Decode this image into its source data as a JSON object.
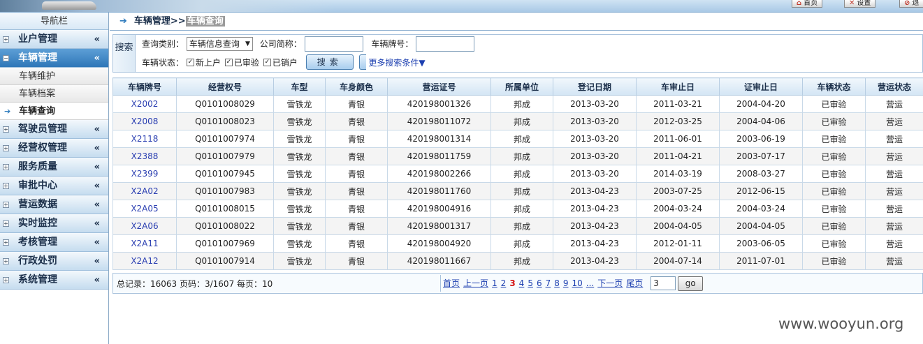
{
  "header": {
    "buttons": [
      {
        "label": "首页",
        "icon": "home-icon"
      },
      {
        "label": "设置",
        "icon": "settings-icon"
      },
      {
        "label": "退",
        "icon": "logout-icon"
      }
    ]
  },
  "sidebar": {
    "title": "导航栏",
    "chevron": "«",
    "menus": [
      {
        "label": "业户管理"
      },
      {
        "label": "车辆管理",
        "active": true,
        "children": [
          {
            "label": "车辆维护"
          },
          {
            "label": "车辆档案"
          },
          {
            "label": "车辆查询",
            "current": true
          }
        ]
      },
      {
        "label": "驾驶员管理"
      },
      {
        "label": "经营权管理"
      },
      {
        "label": "服务质量"
      },
      {
        "label": "审批中心"
      },
      {
        "label": "营运数据"
      },
      {
        "label": "实时监控"
      },
      {
        "label": "考核管理"
      },
      {
        "label": "行政处罚"
      },
      {
        "label": "系统管理"
      }
    ]
  },
  "breadcrumb": {
    "parent": "车辆管理>>",
    "current": "车辆查询"
  },
  "search": {
    "panel_label": "搜索",
    "query_type_label": "查询类别：",
    "query_type_value": "车辆信息查询",
    "company_label": "公司简称：",
    "company_value": "",
    "plate_label": "车辆牌号：",
    "plate_value": "",
    "status_label": "车辆状态：",
    "checkboxes": [
      {
        "label": "新上户",
        "checked": true
      },
      {
        "label": "已审验",
        "checked": true
      },
      {
        "label": "已销户",
        "checked": true
      }
    ],
    "search_button": "搜索",
    "more_conditions": "更多搜索条件▼"
  },
  "table": {
    "columns": [
      "车辆牌号",
      "经营权号",
      "车型",
      "车身颜色",
      "营运证号",
      "所属单位",
      "登记日期",
      "车审止日",
      "证审止日",
      "车辆状态",
      "营运状态"
    ],
    "rows": [
      [
        "X2002",
        "Q0101008029",
        "雪铁龙",
        "青银",
        "420198001326",
        "邦成",
        "2013-03-20",
        "2011-03-21",
        "2004-04-20",
        "已审验",
        "营运"
      ],
      [
        "X2008",
        "Q0101008023",
        "雪铁龙",
        "青银",
        "420198011072",
        "邦成",
        "2013-03-20",
        "2012-03-25",
        "2004-04-06",
        "已审验",
        "营运"
      ],
      [
        "X2118",
        "Q0101007974",
        "雪铁龙",
        "青银",
        "420198001314",
        "邦成",
        "2013-03-20",
        "2011-06-01",
        "2003-06-19",
        "已审验",
        "营运"
      ],
      [
        "X2388",
        "Q0101007979",
        "雪铁龙",
        "青银",
        "420198011759",
        "邦成",
        "2013-03-20",
        "2011-04-21",
        "2003-07-17",
        "已审验",
        "营运"
      ],
      [
        "X2399",
        "Q0101007945",
        "雪铁龙",
        "青银",
        "420198002266",
        "邦成",
        "2013-03-20",
        "2014-03-19",
        "2008-03-27",
        "已审验",
        "营运"
      ],
      [
        "X2A02",
        "Q0101007983",
        "雪铁龙",
        "青银",
        "420198011760",
        "邦成",
        "2013-04-23",
        "2003-07-25",
        "2012-06-15",
        "已审验",
        "营运"
      ],
      [
        "X2A05",
        "Q0101008015",
        "雪铁龙",
        "青银",
        "420198004916",
        "邦成",
        "2013-04-23",
        "2004-03-24",
        "2004-03-24",
        "已审验",
        "营运"
      ],
      [
        "X2A06",
        "Q0101008022",
        "雪铁龙",
        "青银",
        "420198001317",
        "邦成",
        "2013-04-23",
        "2004-04-05",
        "2004-04-05",
        "已审验",
        "营运"
      ],
      [
        "X2A11",
        "Q0101007969",
        "雪铁龙",
        "青银",
        "420198004920",
        "邦成",
        "2013-04-23",
        "2012-01-11",
        "2003-06-05",
        "已审验",
        "营运"
      ],
      [
        "X2A12",
        "Q0101007914",
        "雪铁龙",
        "青银",
        "420198011667",
        "邦成",
        "2013-04-23",
        "2004-07-14",
        "2011-07-01",
        "已审验",
        "营运"
      ]
    ]
  },
  "footer": {
    "summary": "总记录：16063 页码：3/1607 每页：10"
  },
  "pager": {
    "first": "首页",
    "prev": "上一页",
    "pages": [
      "1",
      "2",
      "3",
      "4",
      "5",
      "6",
      "7",
      "8",
      "9",
      "10"
    ],
    "current_page": "3",
    "ellipsis": "...",
    "next": "下一页",
    "last": "尾页",
    "page_input_value": "3",
    "go_button": "go"
  },
  "watermark": "www.wooyun.org"
}
